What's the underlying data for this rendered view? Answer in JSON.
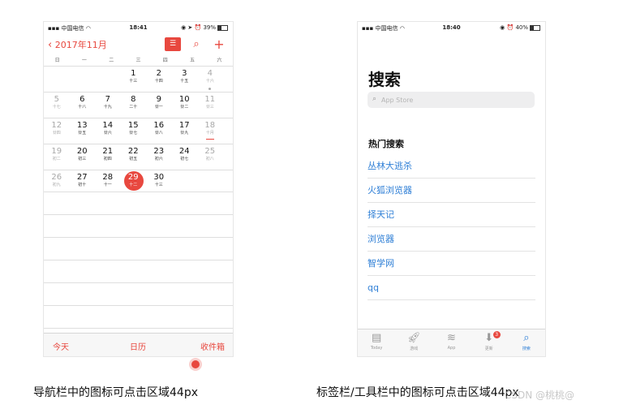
{
  "phone1": {
    "status": {
      "carrier": "中国电信",
      "time": "18:41",
      "battery": "39%"
    },
    "nav": {
      "back_label": "2017年11月",
      "back_icon": "chevron-left-icon"
    },
    "weekdays": [
      "日",
      "一",
      "二",
      "三",
      "四",
      "五",
      "六"
    ],
    "weeks": [
      [
        {
          "n": "",
          "l": ""
        },
        {
          "n": "",
          "l": ""
        },
        {
          "n": "",
          "l": ""
        },
        {
          "n": "1",
          "l": "十三"
        },
        {
          "n": "2",
          "l": "十四"
        },
        {
          "n": "3",
          "l": "十五"
        },
        {
          "n": "4",
          "l": "十六"
        }
      ],
      [
        {
          "n": "5",
          "l": "十七"
        },
        {
          "n": "6",
          "l": "十八"
        },
        {
          "n": "7",
          "l": "十九"
        },
        {
          "n": "8",
          "l": "二十"
        },
        {
          "n": "9",
          "l": "廿一"
        },
        {
          "n": "10",
          "l": "廿二"
        },
        {
          "n": "11",
          "l": "廿三"
        }
      ],
      [
        {
          "n": "12",
          "l": "廿四"
        },
        {
          "n": "13",
          "l": "廿五"
        },
        {
          "n": "14",
          "l": "廿六"
        },
        {
          "n": "15",
          "l": "廿七"
        },
        {
          "n": "16",
          "l": "廿八"
        },
        {
          "n": "17",
          "l": "廿九"
        },
        {
          "n": "18",
          "l": "十月"
        }
      ],
      [
        {
          "n": "19",
          "l": "初二"
        },
        {
          "n": "20",
          "l": "初三"
        },
        {
          "n": "21",
          "l": "初四"
        },
        {
          "n": "22",
          "l": "初五"
        },
        {
          "n": "23",
          "l": "初六"
        },
        {
          "n": "24",
          "l": "初七"
        },
        {
          "n": "25",
          "l": "初八"
        }
      ],
      [
        {
          "n": "26",
          "l": "初九"
        },
        {
          "n": "27",
          "l": "初十"
        },
        {
          "n": "28",
          "l": "十一"
        },
        {
          "n": "29",
          "l": "十二"
        },
        {
          "n": "30",
          "l": "十三"
        },
        {
          "n": "",
          "l": ""
        },
        {
          "n": "",
          "l": ""
        }
      ]
    ],
    "today": "29",
    "toolbar": {
      "today": "今天",
      "calendars": "日历",
      "inbox": "收件箱"
    },
    "accent": "#e8483f"
  },
  "phone2": {
    "status": {
      "carrier": "中国电信",
      "time": "18:40",
      "battery": "40%"
    },
    "title": "搜索",
    "search_placeholder": "App Store",
    "hot_title": "热门搜索",
    "hot_items": [
      "丛林大逃杀",
      "火狐浏览器",
      "择天记",
      "浏览器",
      "智学网",
      "qq"
    ],
    "tabs": [
      {
        "label": "Today",
        "icon": "today-icon"
      },
      {
        "label": "游戏",
        "icon": "rocket-icon"
      },
      {
        "label": "App",
        "icon": "layers-icon"
      },
      {
        "label": "更新",
        "icon": "download-icon",
        "badge": "3"
      },
      {
        "label": "搜索",
        "icon": "search-icon",
        "active": true
      }
    ],
    "accent": "#2f7fd6"
  },
  "captions": {
    "left": "导航栏中的图标可点击区域44px",
    "right": "标签栏/工具栏中的图标可点击区域44px"
  },
  "watermark": "CSDN @桃桃@"
}
